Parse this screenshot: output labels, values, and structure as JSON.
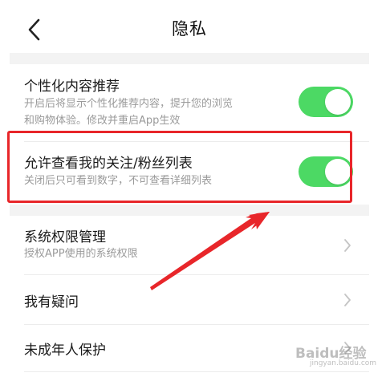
{
  "header": {
    "title": "隐私"
  },
  "settings": [
    {
      "title": "个性化内容推荐",
      "desc_line1": "开启后将显示个性化推荐内容，提升您的浏览",
      "desc_line2": "和购物体验。修改并重启App生效",
      "toggle_on": true
    },
    {
      "title": "允许查看我的关注/粉丝列表",
      "desc_line1": "关闭后只可看到数字，不可查看详细列表",
      "toggle_on": true
    },
    {
      "title": "系统权限管理",
      "desc_line1": "授权APP使用的系统权限"
    },
    {
      "title": "我有疑问"
    },
    {
      "title": "未成年人保护"
    }
  ],
  "annotation": {
    "highlight_color": "#e8262a",
    "arrow_color": "#e8262a"
  },
  "watermark": {
    "text": "Baidu经验",
    "sub": "jingyan.baidu.com"
  },
  "colors": {
    "toggle_on": "#4cd964",
    "gap": "#f3f3f3"
  }
}
